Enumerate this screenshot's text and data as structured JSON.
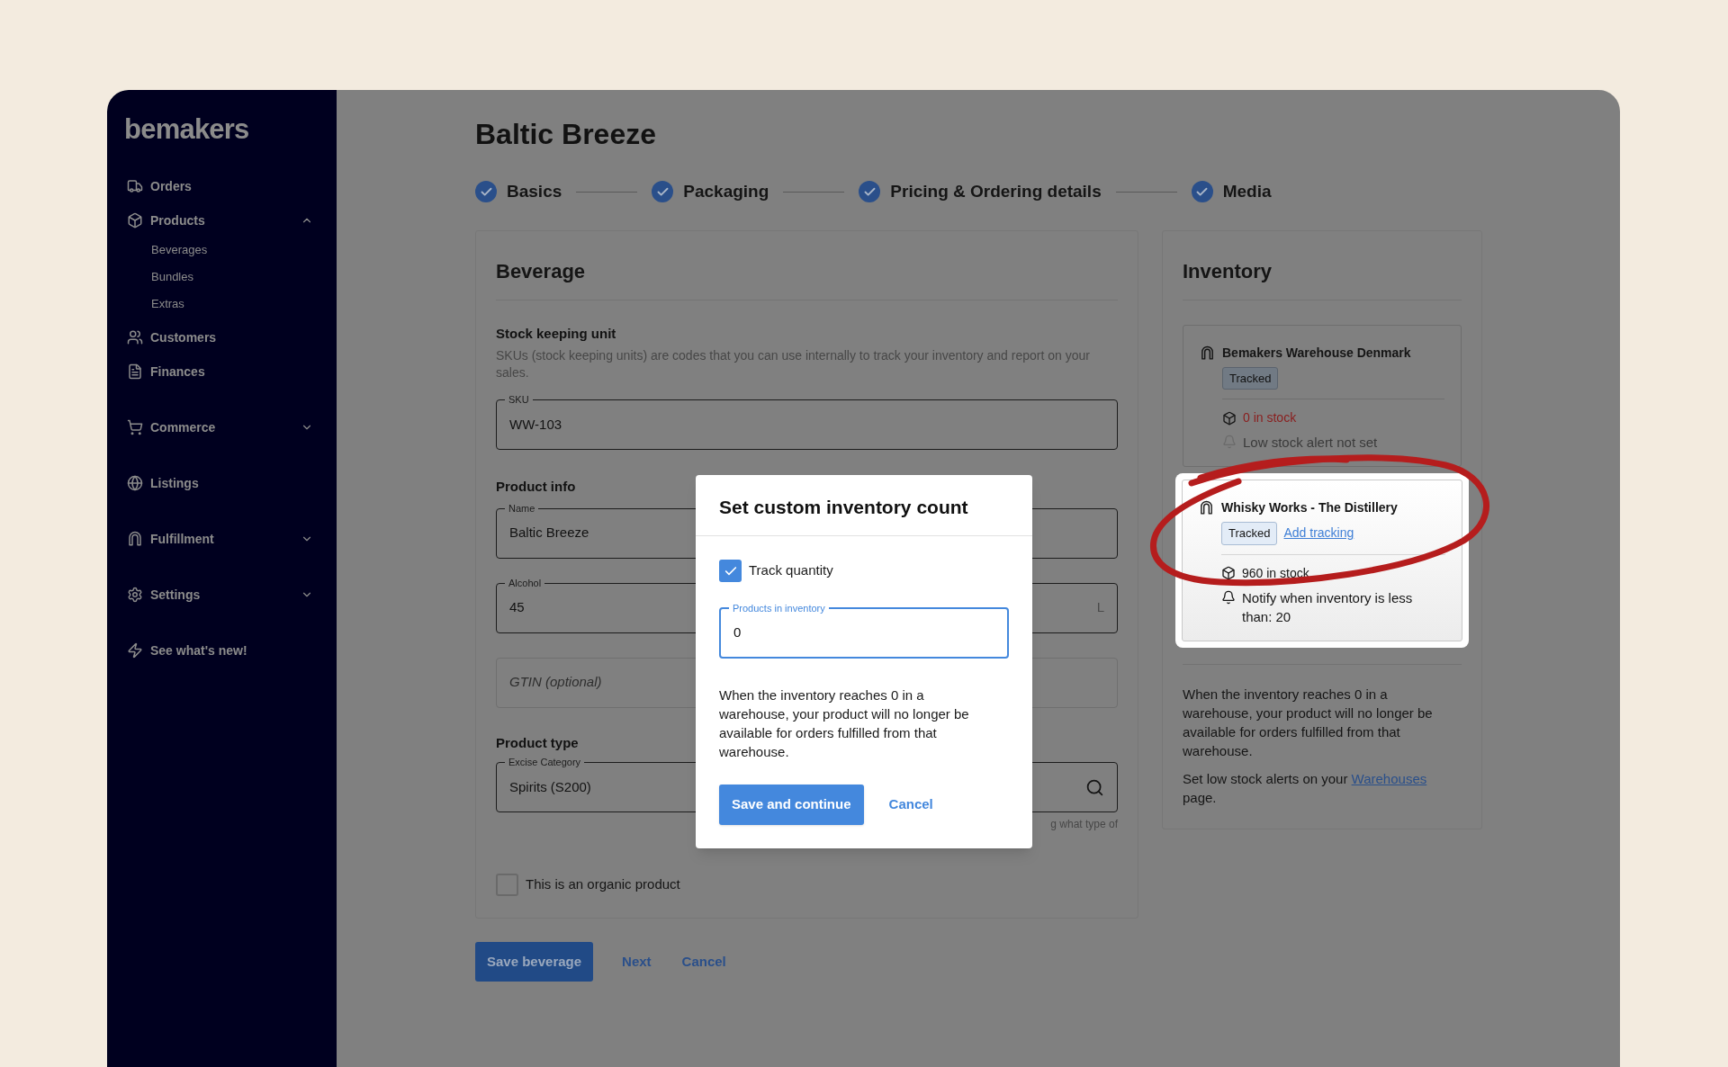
{
  "sidebar": {
    "logo": "bemakers",
    "items": [
      {
        "label": "Orders",
        "kind": "link"
      },
      {
        "label": "Products",
        "kind": "group",
        "expanded": true,
        "children": [
          {
            "label": "Beverages"
          },
          {
            "label": "Bundles"
          },
          {
            "label": "Extras"
          }
        ]
      },
      {
        "label": "Customers",
        "kind": "link"
      },
      {
        "label": "Finances",
        "kind": "link"
      },
      {
        "label": "Commerce",
        "kind": "group",
        "expanded": false
      },
      {
        "label": "Listings",
        "kind": "link"
      },
      {
        "label": "Fulfillment",
        "kind": "group",
        "expanded": false
      },
      {
        "label": "Settings",
        "kind": "group",
        "expanded": false
      },
      {
        "label": "See what's new!",
        "kind": "link"
      }
    ]
  },
  "page": {
    "title": "Baltic Breeze",
    "steps": [
      {
        "label": "Basics",
        "completed": true
      },
      {
        "label": "Packaging",
        "completed": true
      },
      {
        "label": "Pricing & Ordering details",
        "completed": true
      },
      {
        "label": "Media",
        "completed": true
      }
    ]
  },
  "beverage_card": {
    "title": "Beverage",
    "sku_section": {
      "heading": "Stock keeping unit",
      "description": "SKUs (stock keeping units) are codes that you can use internally to track your inventory and report on your sales.",
      "field": {
        "label": "SKU",
        "value": "WW-103"
      }
    },
    "product_info": {
      "heading": "Product info",
      "fields": [
        {
          "label": "Name",
          "value": "Baltic Breeze"
        },
        {
          "label": "Alcohol",
          "value": "45",
          "suffix": "L"
        },
        {
          "placeholder": "GTIN (optional)"
        }
      ]
    },
    "product_type": {
      "heading": "Product type",
      "field": {
        "label": "Excise Category",
        "value": "Spirits (S200)"
      },
      "helper": "g what type of"
    },
    "organic": {
      "label": "This is an organic product",
      "checked": false
    }
  },
  "footer_buttons": [
    {
      "label": "Save beverage",
      "kind": "primary"
    },
    {
      "label": "Next",
      "kind": "link"
    },
    {
      "label": "Cancel",
      "kind": "link"
    }
  ],
  "inventory": {
    "title": "Inventory",
    "warehouses": [
      {
        "name": "Bemakers Warehouse Denmark",
        "badge": "Tracked",
        "stock": "0 in stock",
        "out_of_stock": true,
        "alert": "Low stock alert not set",
        "alert_set": false,
        "highlighted": false
      },
      {
        "name": "Whisky Works - The Distillery",
        "badge": "Tracked",
        "link": "Add tracking",
        "stock": "960 in stock",
        "out_of_stock": false,
        "alert": "Notify when inventory is less than: 20",
        "alert_set": true,
        "highlighted": true
      }
    ],
    "note": "When the inventory reaches 0 in a warehouse, your product will no longer be available for orders fulfilled from that warehouse.",
    "alert_note": {
      "before": "Set low stock alerts on your",
      "link": "Warehouses",
      "after": "page."
    }
  },
  "modal": {
    "title": "Set custom inventory count",
    "track": {
      "label": "Track quantity",
      "checked": true
    },
    "field": {
      "label": "Products in inventory",
      "value": "0"
    },
    "note": "When the inventory reaches 0 in a warehouse, your product will no longer be available for orders fulfilled from that warehouse.",
    "buttons": [
      {
        "label": "Save and continue",
        "kind": "primary"
      },
      {
        "label": "Cancel",
        "kind": "link"
      }
    ]
  }
}
